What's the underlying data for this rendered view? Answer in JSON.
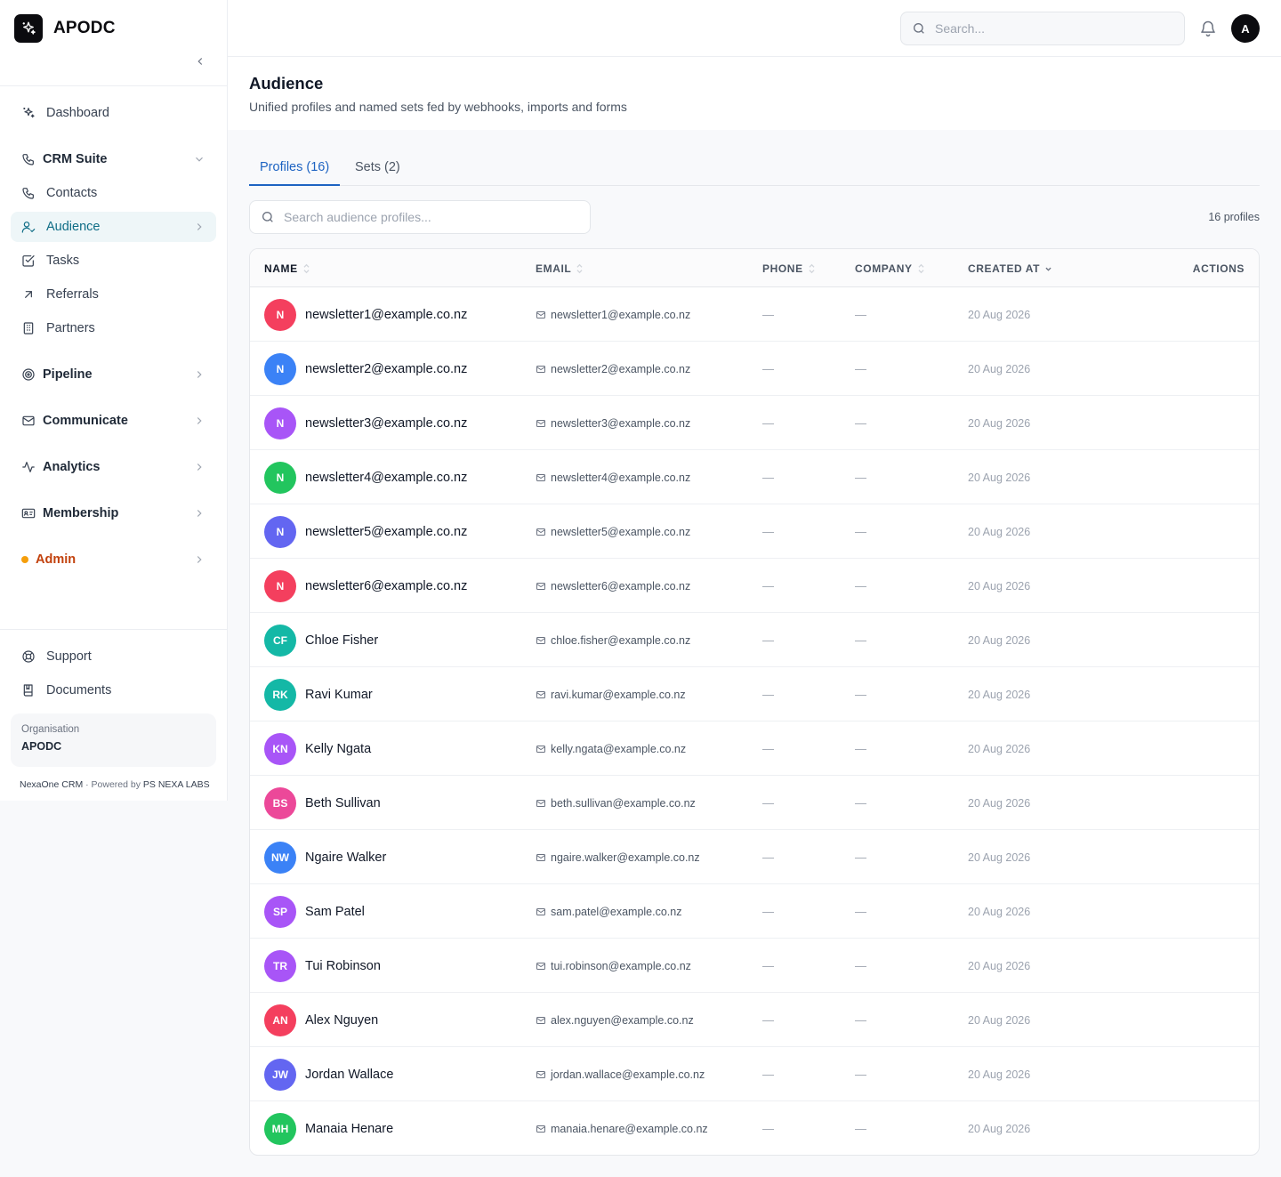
{
  "brand": {
    "name": "APODC"
  },
  "sidebar": {
    "items": [
      {
        "key": "dashboard",
        "label": "Dashboard"
      },
      {
        "key": "crm-suite",
        "label": "CRM Suite"
      },
      {
        "key": "contacts",
        "label": "Contacts"
      },
      {
        "key": "audience",
        "label": "Audience"
      },
      {
        "key": "tasks",
        "label": "Tasks"
      },
      {
        "key": "referrals",
        "label": "Referrals"
      },
      {
        "key": "partners",
        "label": "Partners"
      },
      {
        "key": "pipeline",
        "label": "Pipeline"
      },
      {
        "key": "communicate",
        "label": "Communicate"
      },
      {
        "key": "analytics",
        "label": "Analytics"
      },
      {
        "key": "membership",
        "label": "Membership"
      },
      {
        "key": "admin",
        "label": "Admin"
      },
      {
        "key": "support",
        "label": "Support"
      },
      {
        "key": "documents",
        "label": "Documents"
      }
    ],
    "organisation_label": "Organisation",
    "organisation_name": "APODC",
    "footer_product": "NexaOne CRM",
    "footer_separator": "·",
    "footer_powered": "Powered by",
    "footer_company": "PS NEXA LABS"
  },
  "topbar": {
    "search_placeholder": "Search...",
    "user_initial": "A"
  },
  "page": {
    "title": "Audience",
    "subtitle": "Unified profiles and named sets fed by webhooks, imports and forms"
  },
  "tabs": [
    {
      "label": "Profiles (16)",
      "active": true
    },
    {
      "label": "Sets (2)",
      "active": false
    }
  ],
  "profiles": {
    "search_placeholder": "Search audience profiles...",
    "count_label": "16 profiles",
    "columns": {
      "name": "NAME",
      "email": "EMAIL",
      "phone": "PHONE",
      "company": "COMPANY",
      "created_at": "CREATED AT",
      "actions": "ACTIONS"
    },
    "rows": [
      {
        "initials": "N",
        "color": "#f43f5e",
        "name": "newsletter1@example.co.nz",
        "email": "newsletter1@example.co.nz",
        "phone": "—",
        "company": "—",
        "created": "20 Aug 2026"
      },
      {
        "initials": "N",
        "color": "#3b82f6",
        "name": "newsletter2@example.co.nz",
        "email": "newsletter2@example.co.nz",
        "phone": "—",
        "company": "—",
        "created": "20 Aug 2026"
      },
      {
        "initials": "N",
        "color": "#a855f7",
        "name": "newsletter3@example.co.nz",
        "email": "newsletter3@example.co.nz",
        "phone": "—",
        "company": "—",
        "created": "20 Aug 2026"
      },
      {
        "initials": "N",
        "color": "#22c55e",
        "name": "newsletter4@example.co.nz",
        "email": "newsletter4@example.co.nz",
        "phone": "—",
        "company": "—",
        "created": "20 Aug 2026"
      },
      {
        "initials": "N",
        "color": "#6366f1",
        "name": "newsletter5@example.co.nz",
        "email": "newsletter5@example.co.nz",
        "phone": "—",
        "company": "—",
        "created": "20 Aug 2026"
      },
      {
        "initials": "N",
        "color": "#f43f5e",
        "name": "newsletter6@example.co.nz",
        "email": "newsletter6@example.co.nz",
        "phone": "—",
        "company": "—",
        "created": "20 Aug 2026"
      },
      {
        "initials": "CF",
        "color": "#14b8a6",
        "name": "Chloe Fisher",
        "email": "chloe.fisher@example.co.nz",
        "phone": "—",
        "company": "—",
        "created": "20 Aug 2026"
      },
      {
        "initials": "RK",
        "color": "#14b8a6",
        "name": "Ravi Kumar",
        "email": "ravi.kumar@example.co.nz",
        "phone": "—",
        "company": "—",
        "created": "20 Aug 2026"
      },
      {
        "initials": "KN",
        "color": "#a855f7",
        "name": "Kelly Ngata",
        "email": "kelly.ngata@example.co.nz",
        "phone": "—",
        "company": "—",
        "created": "20 Aug 2026"
      },
      {
        "initials": "BS",
        "color": "#ec4899",
        "name": "Beth Sullivan",
        "email": "beth.sullivan@example.co.nz",
        "phone": "—",
        "company": "—",
        "created": "20 Aug 2026"
      },
      {
        "initials": "NW",
        "color": "#3b82f6",
        "name": "Ngaire Walker",
        "email": "ngaire.walker@example.co.nz",
        "phone": "—",
        "company": "—",
        "created": "20 Aug 2026"
      },
      {
        "initials": "SP",
        "color": "#a855f7",
        "name": "Sam Patel",
        "email": "sam.patel@example.co.nz",
        "phone": "—",
        "company": "—",
        "created": "20 Aug 2026"
      },
      {
        "initials": "TR",
        "color": "#a855f7",
        "name": "Tui Robinson",
        "email": "tui.robinson@example.co.nz",
        "phone": "—",
        "company": "—",
        "created": "20 Aug 2026"
      },
      {
        "initials": "AN",
        "color": "#f43f5e",
        "name": "Alex Nguyen",
        "email": "alex.nguyen@example.co.nz",
        "phone": "—",
        "company": "—",
        "created": "20 Aug 2026"
      },
      {
        "initials": "JW",
        "color": "#6366f1",
        "name": "Jordan Wallace",
        "email": "jordan.wallace@example.co.nz",
        "phone": "—",
        "company": "—",
        "created": "20 Aug 2026"
      },
      {
        "initials": "MH",
        "color": "#22c55e",
        "name": "Manaia Henare",
        "email": "manaia.henare@example.co.nz",
        "phone": "—",
        "company": "—",
        "created": "20 Aug 2026"
      }
    ]
  }
}
